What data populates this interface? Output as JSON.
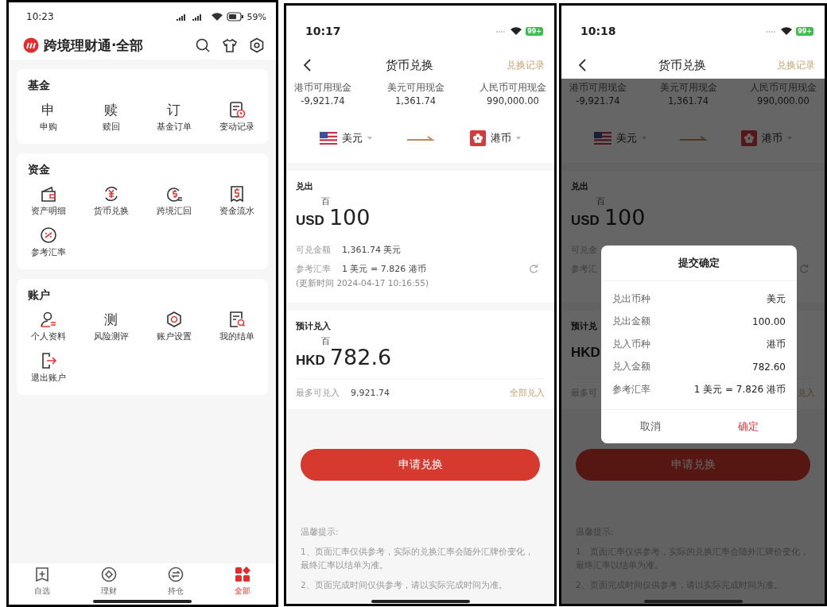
{
  "screens": [
    {
      "kind": "menu",
      "status_bar": {
        "time": "10:23",
        "battery": "59%"
      },
      "title": "跨境理财通·全部",
      "sections": [
        {
          "title": "基金",
          "items": [
            {
              "label": "申购",
              "kind": "glyph",
              "glyph": "申"
            },
            {
              "label": "赎回",
              "kind": "glyph",
              "glyph": "赎"
            },
            {
              "label": "基金订单",
              "kind": "glyph",
              "glyph": "订"
            },
            {
              "label": "变动记录",
              "kind": "doc-clock"
            }
          ]
        },
        {
          "title": "资金",
          "items": [
            {
              "label": "资产明细",
              "kind": "wallet"
            },
            {
              "label": "货币兑换",
              "kind": "yen-cycle"
            },
            {
              "label": "跨境汇回",
              "kind": "dollar-coin"
            },
            {
              "label": "资金流水",
              "kind": "receipt"
            },
            {
              "label": "参考汇率",
              "kind": "percent"
            }
          ]
        },
        {
          "title": "账户",
          "items": [
            {
              "label": "个人资料",
              "kind": "person"
            },
            {
              "label": "风险测评",
              "kind": "glyph",
              "glyph": "测"
            },
            {
              "label": "账户设置",
              "kind": "hexagon"
            },
            {
              "label": "我的结单",
              "kind": "doc-search"
            },
            {
              "label": "退出账户",
              "kind": "logout"
            }
          ]
        }
      ],
      "tab_bar": [
        {
          "label": "自选",
          "kind": "bookmark",
          "selected": false
        },
        {
          "label": "理财",
          "kind": "diamond",
          "selected": false
        },
        {
          "label": "持仓",
          "kind": "swap",
          "selected": false
        },
        {
          "label": "全部",
          "kind": "grid",
          "selected": true
        }
      ]
    },
    {
      "kind": "exchange",
      "status_bar": {
        "time": "10:17",
        "battery": "99+"
      },
      "nav": {
        "title": "货币兑换",
        "action": "兑换记录"
      },
      "balances": [
        {
          "label": "港币可用现金",
          "value": "-9,921.74"
        },
        {
          "label": "美元可用现金",
          "value": "1,361.74"
        },
        {
          "label": "人民币可用现金",
          "value": "990,000.00"
        }
      ],
      "from_currency": "美元",
      "to_currency": "港币",
      "sell": {
        "label": "兑出",
        "unit": "百",
        "code": "USD",
        "amount": "100"
      },
      "available": {
        "label": "可兑金额",
        "value": "1,361.74 美元"
      },
      "rate": {
        "label": "参考汇率",
        "value": "1 美元 = 7.826 港币"
      },
      "updated": "(更新时间 2024-04-17 10:16:55)",
      "buy": {
        "label": "预计兑入",
        "unit": "百",
        "code": "HKD",
        "amount": "782.6"
      },
      "max": {
        "label": "最多可兑入",
        "value": "9,921.74",
        "action": "全部兑入"
      },
      "submit": "申请兑换",
      "tips_title": "温馨提示:",
      "tips": [
        "1、页面汇率仅供参考，实际的兑换汇率会随外汇牌价变化，最终汇率以结单为准。",
        "2、页面完成时间仅供参考，请以实际完成时间为准。"
      ]
    },
    {
      "kind": "exchange",
      "status_bar": {
        "time": "10:18",
        "battery": "99+"
      },
      "nav": {
        "title": "货币兑换",
        "action": "兑换记录"
      },
      "balances": [
        {
          "label": "港币可用现金",
          "value": "-9,921.74"
        },
        {
          "label": "美元可用现金",
          "value": "1,361.74"
        },
        {
          "label": "人民币可用现金",
          "value": "990,000.00"
        }
      ],
      "from_currency": "美元",
      "to_currency": "港币",
      "sell": {
        "label": "兑出",
        "unit": "百",
        "code": "USD",
        "amount": "100"
      },
      "available": {
        "label": "可兑金"
      },
      "rate": {
        "label": "参考汇"
      },
      "buy": {
        "label": "预计兑",
        "code": "HKD"
      },
      "max": {
        "label": "最多可",
        "action": "兑入"
      },
      "submit": "申请兑换",
      "tips_title": "温馨提示:",
      "tips": [
        "1、页面汇率仅供参考，实际的兑换汇率会随外汇牌价变化，最终汇率以结单为准。",
        "2、页面完成时间仅供参考，请以实际完成时间为准。"
      ],
      "dialog": {
        "title": "提交确定",
        "rows": [
          {
            "label": "兑出币种",
            "value": "美元"
          },
          {
            "label": "兑出金额",
            "value": "100.00"
          },
          {
            "label": "兑入币种",
            "value": "港币"
          },
          {
            "label": "兑入金额",
            "value": "782.60"
          },
          {
            "label": "参考汇率",
            "value": "1 美元 = 7.826 港币"
          }
        ],
        "cancel": "取消",
        "confirm": "确定"
      }
    }
  ]
}
